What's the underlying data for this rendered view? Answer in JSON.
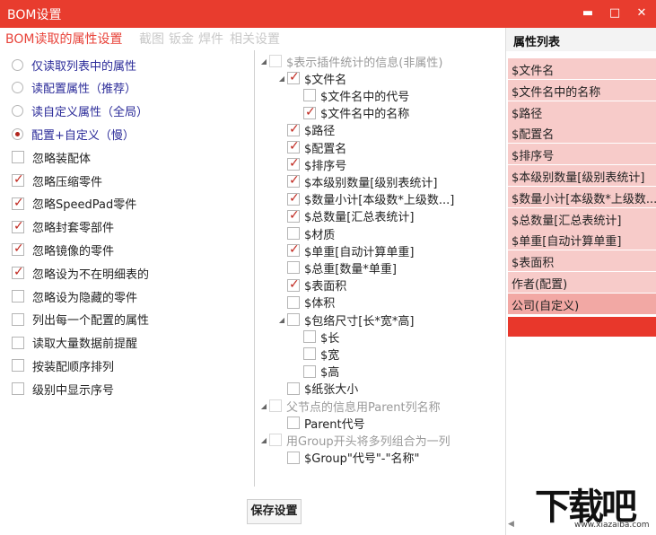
{
  "window": {
    "title": "BOM设置",
    "minimize_glyph": "▬",
    "maximize_glyph": "□",
    "close_glyph": "✕"
  },
  "tabs": [
    {
      "label": "BOM读取的属性设置",
      "active": true
    },
    {
      "label": "截图",
      "active": false
    },
    {
      "label": "钣金",
      "active": false
    },
    {
      "label": "焊件",
      "active": false
    },
    {
      "label": "相关设置",
      "active": false
    }
  ],
  "left_options": {
    "radios": [
      {
        "label": "仅读取列表中的属性",
        "selected": false
      },
      {
        "label": "读配置属性（推荐）",
        "selected": false
      },
      {
        "label": "读自定义属性（全局）",
        "selected": false
      },
      {
        "label": "配置+自定义（慢）",
        "selected": true
      }
    ],
    "checkboxes": [
      {
        "label": "忽略装配体",
        "checked": false
      },
      {
        "label": "忽略压缩零件",
        "checked": true
      },
      {
        "label": "忽略SpeedPad零件",
        "checked": true
      },
      {
        "label": "忽略封套零部件",
        "checked": true
      },
      {
        "label": "忽略镜像的零件",
        "checked": true
      },
      {
        "label": "忽略设为不在明细表的",
        "checked": true
      },
      {
        "label": "忽略设为隐藏的零件",
        "checked": false
      },
      {
        "label": "列出每一个配置的属性",
        "checked": false
      },
      {
        "label": "读取大量数据前提醒",
        "checked": false
      },
      {
        "label": "按装配顺序排列",
        "checked": false
      },
      {
        "label": "级别中显示序号",
        "checked": false
      }
    ]
  },
  "tree": [
    {
      "label": "$表示插件统计的信息(非属性)",
      "level": 0,
      "checked": false,
      "dim": true,
      "expander": "◢"
    },
    {
      "label": "$文件名",
      "level": 1,
      "checked": true,
      "dim": false,
      "expander": "◢"
    },
    {
      "label": "$文件名中的代号",
      "level": 2,
      "checked": false,
      "dim": false,
      "expander": ""
    },
    {
      "label": "$文件名中的名称",
      "level": 2,
      "checked": true,
      "dim": false,
      "expander": ""
    },
    {
      "label": "$路径",
      "level": 1,
      "checked": true,
      "dim": false,
      "expander": ""
    },
    {
      "label": "$配置名",
      "level": 1,
      "checked": true,
      "dim": false,
      "expander": ""
    },
    {
      "label": "$排序号",
      "level": 1,
      "checked": true,
      "dim": false,
      "expander": ""
    },
    {
      "label": "$本级别数量[级别表统计]",
      "level": 1,
      "checked": true,
      "dim": false,
      "expander": ""
    },
    {
      "label": "$数量小计[本级数*上级数...]",
      "level": 1,
      "checked": true,
      "dim": false,
      "expander": ""
    },
    {
      "label": "$总数量[汇总表统计]",
      "level": 1,
      "checked": true,
      "dim": false,
      "expander": ""
    },
    {
      "label": "$材质",
      "level": 1,
      "checked": false,
      "dim": false,
      "expander": ""
    },
    {
      "label": "$单重[自动计算单重]",
      "level": 1,
      "checked": true,
      "dim": false,
      "expander": ""
    },
    {
      "label": "$总重[数量*单重]",
      "level": 1,
      "checked": false,
      "dim": false,
      "expander": ""
    },
    {
      "label": "$表面积",
      "level": 1,
      "checked": true,
      "dim": false,
      "expander": ""
    },
    {
      "label": "$体积",
      "level": 1,
      "checked": false,
      "dim": false,
      "expander": ""
    },
    {
      "label": "$包络尺寸[长*宽*高]",
      "level": 1,
      "checked": false,
      "dim": false,
      "expander": "◢"
    },
    {
      "label": "$长",
      "level": 2,
      "checked": false,
      "dim": false,
      "expander": ""
    },
    {
      "label": "$宽",
      "level": 2,
      "checked": false,
      "dim": false,
      "expander": ""
    },
    {
      "label": "$高",
      "level": 2,
      "checked": false,
      "dim": false,
      "expander": ""
    },
    {
      "label": "$纸张大小",
      "level": 1,
      "checked": false,
      "dim": false,
      "expander": ""
    },
    {
      "label": "父节点的信息用Parent列名称",
      "level": 0,
      "checked": false,
      "dim": true,
      "expander": "◢"
    },
    {
      "label": "Parent代号",
      "level": 1,
      "checked": false,
      "dim": false,
      "expander": ""
    },
    {
      "label": "用Group开头将多列组合为一列",
      "level": 0,
      "checked": false,
      "dim": true,
      "expander": "◢"
    },
    {
      "label": "$Group\"代号\"-\"名称\"",
      "level": 1,
      "checked": false,
      "dim": false,
      "expander": ""
    }
  ],
  "save_button": {
    "label": "保存设置"
  },
  "property_list": {
    "header": "属性列表",
    "items": [
      {
        "label": "$文件名",
        "selected": false
      },
      {
        "label": "$文件名中的名称",
        "selected": false
      },
      {
        "label": "$路径",
        "selected": false
      },
      {
        "label": "$配置名",
        "selected": false
      },
      {
        "label": "$排序号",
        "selected": false
      },
      {
        "label": "$本级别数量[级别表统计]",
        "selected": false
      },
      {
        "label": "$数量小计[本级数*上级数...]",
        "selected": false
      },
      {
        "label": "$总数量[汇总表统计]",
        "selected": false
      },
      {
        "label": "$单重[自动计算单重]",
        "selected": false
      },
      {
        "label": "$表面积",
        "selected": false
      },
      {
        "label": "作者(配置)",
        "selected": false
      },
      {
        "label": "公司(自定义)",
        "selected": true
      }
    ],
    "scroll_glyph": "◀"
  },
  "watermark": {
    "big": "下载吧",
    "small": "www.xiazaiba.com"
  },
  "colors": {
    "titlebar": "#e83c2e",
    "accent": "#e8433a",
    "list_item": "#f7cbc9",
    "list_selected": "#f2a8a4",
    "list_bar": "#e8372b"
  }
}
